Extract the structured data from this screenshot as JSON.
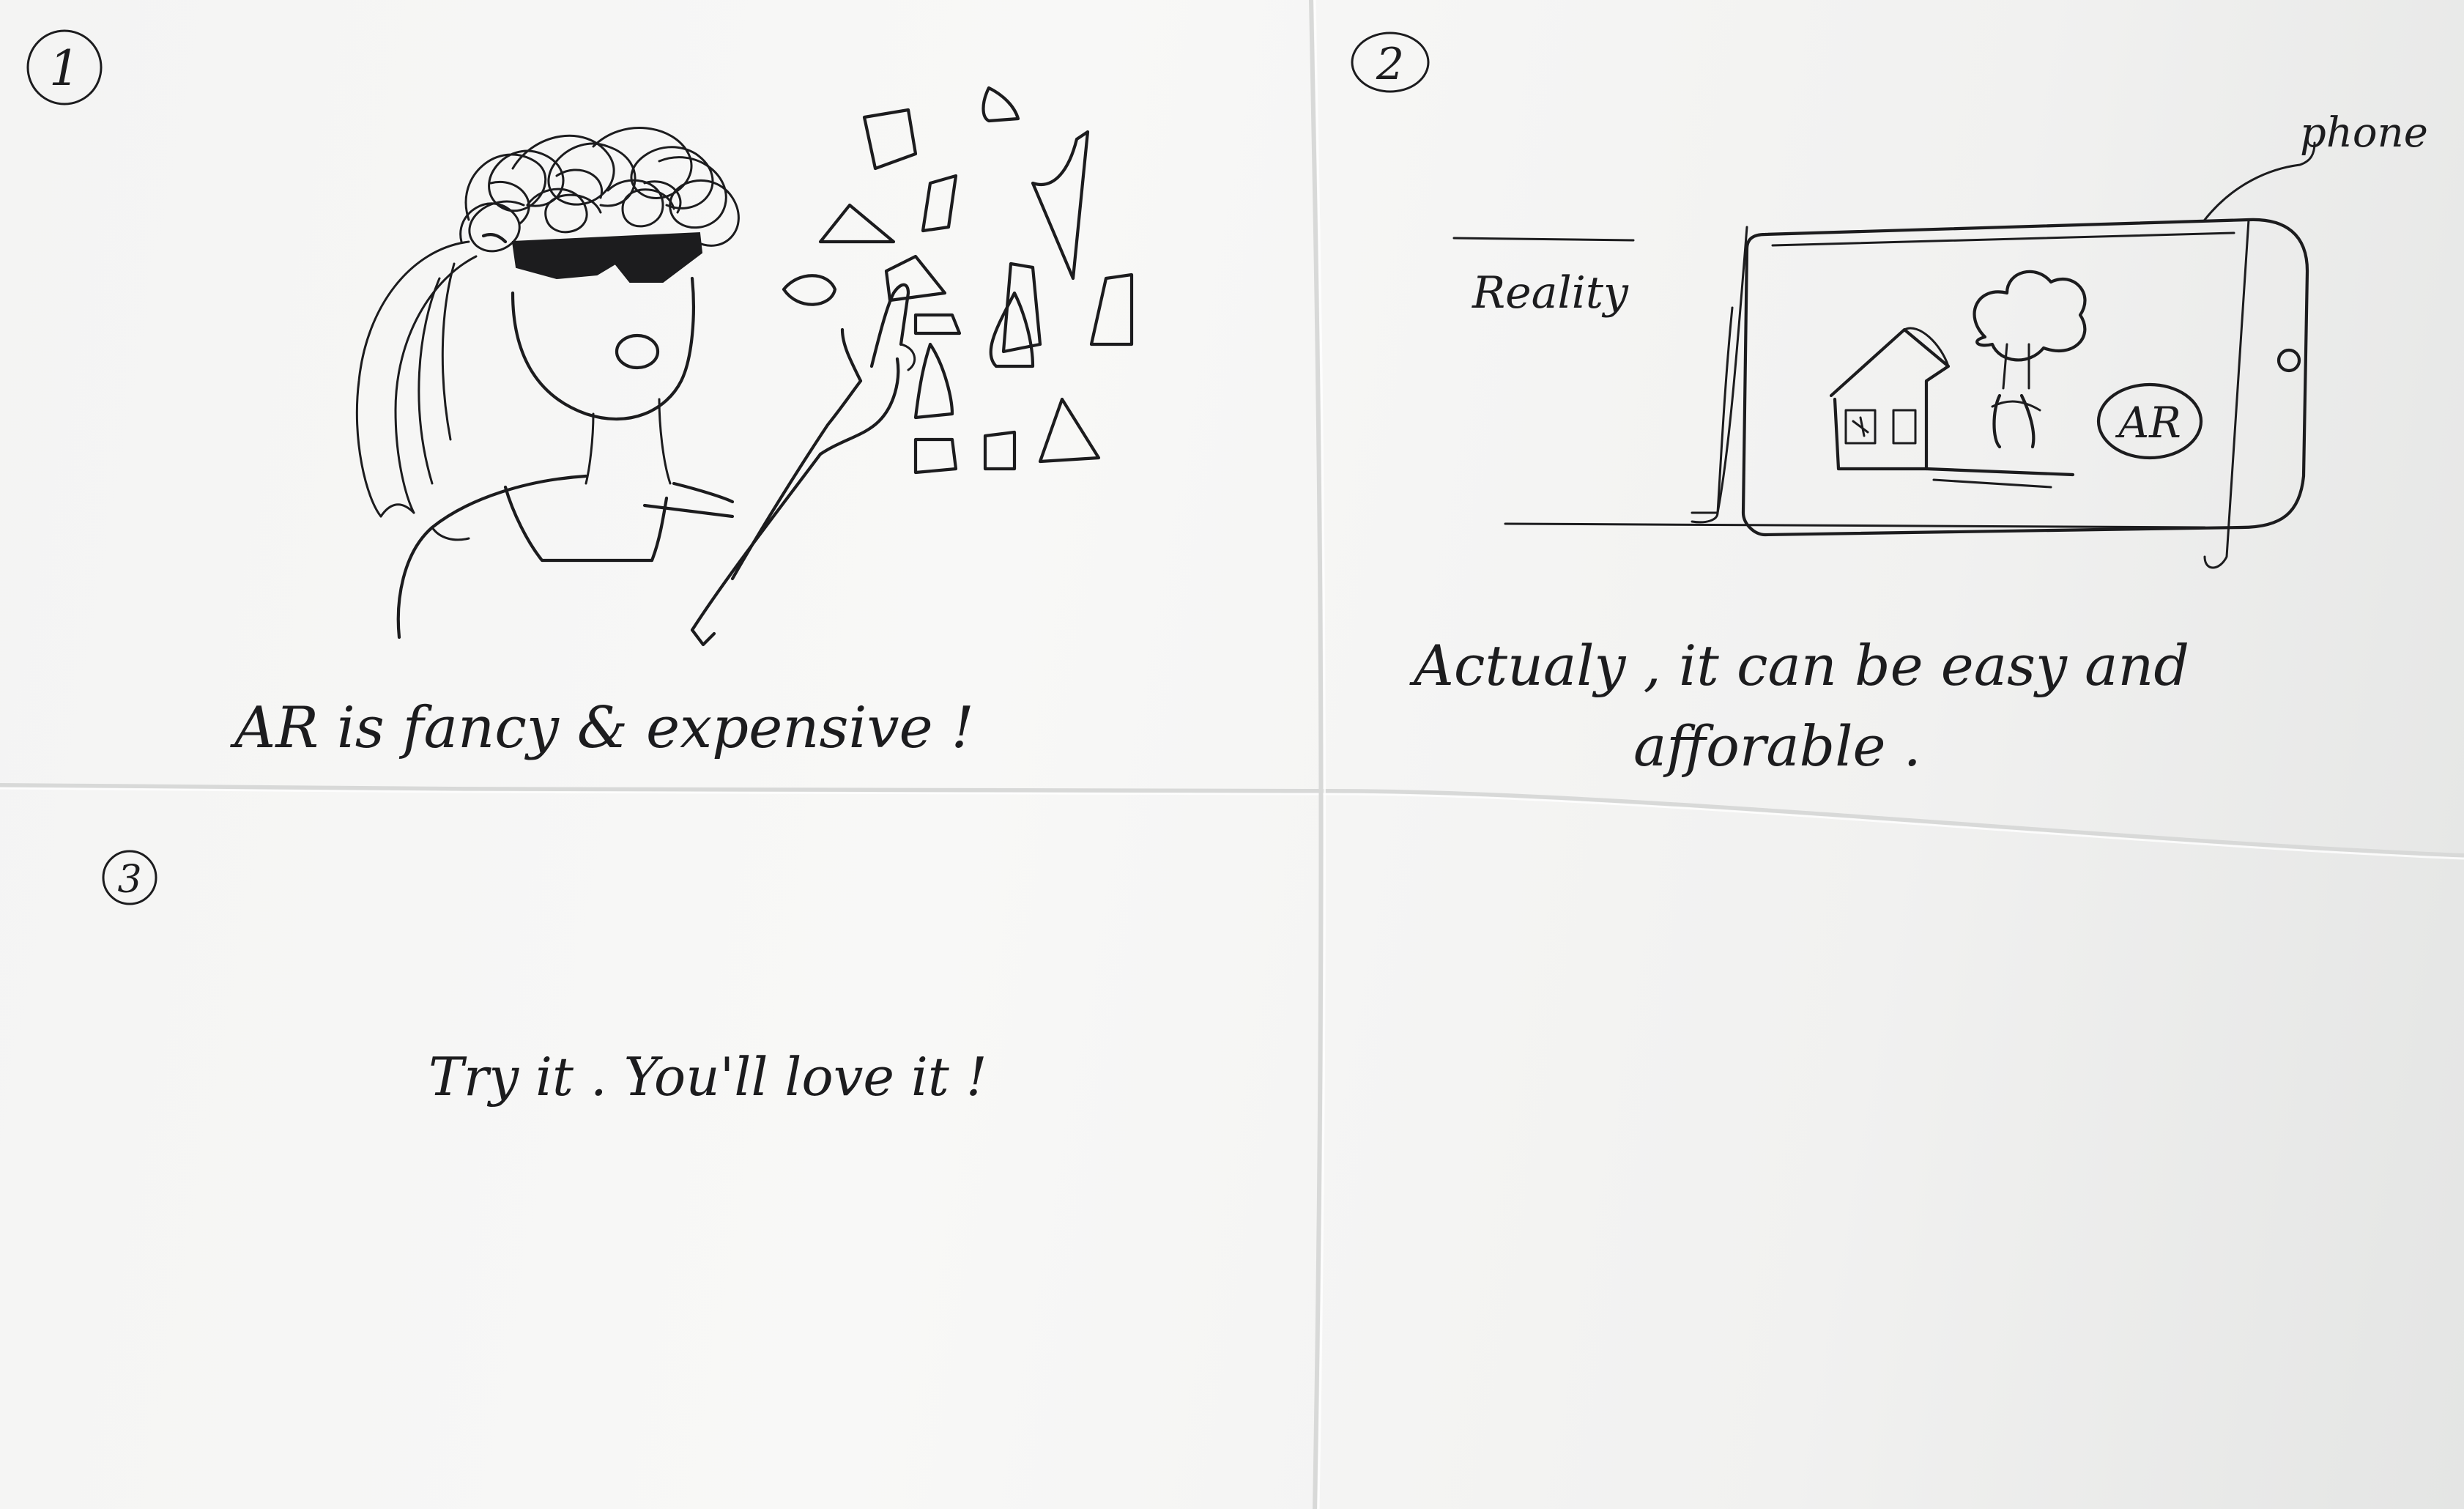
{
  "panels": [
    {
      "number": "1",
      "caption": "AR is fancy & expensive !"
    },
    {
      "number": "2",
      "caption_line1": "Actualy , it can be easy and",
      "caption_line2": "afforable .",
      "reality_label": "Reality",
      "phone_label": "phone",
      "ar_badge": "AR"
    },
    {
      "number": "3",
      "caption": "Try it . You'll love it !"
    }
  ]
}
